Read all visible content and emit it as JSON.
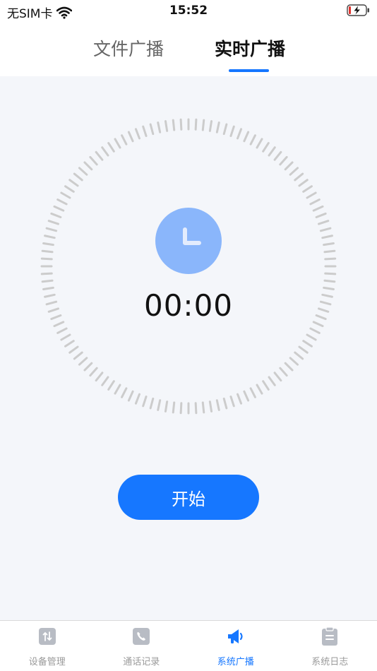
{
  "status_bar": {
    "carrier": "无SIM卡",
    "time": "15:52",
    "battery_state": "charging-low"
  },
  "tabs": [
    {
      "label": "文件广播",
      "active": false
    },
    {
      "label": "实时广播",
      "active": true
    }
  ],
  "timer": {
    "display": "00:00"
  },
  "start_button": {
    "label": "开始"
  },
  "bottom_nav": [
    {
      "label": "设备管理",
      "icon": "device-management-icon",
      "active": false
    },
    {
      "label": "通话记录",
      "icon": "phone-icon",
      "active": false
    },
    {
      "label": "系统广播",
      "icon": "megaphone-icon",
      "active": true
    },
    {
      "label": "系统日志",
      "icon": "clipboard-icon",
      "active": false
    }
  ],
  "colors": {
    "accent": "#1677ff",
    "clock_badge": "#8ab6fb",
    "background": "#f4f6fa",
    "tick": "#cccccc",
    "inactive_nav": "#b8bcc4"
  }
}
